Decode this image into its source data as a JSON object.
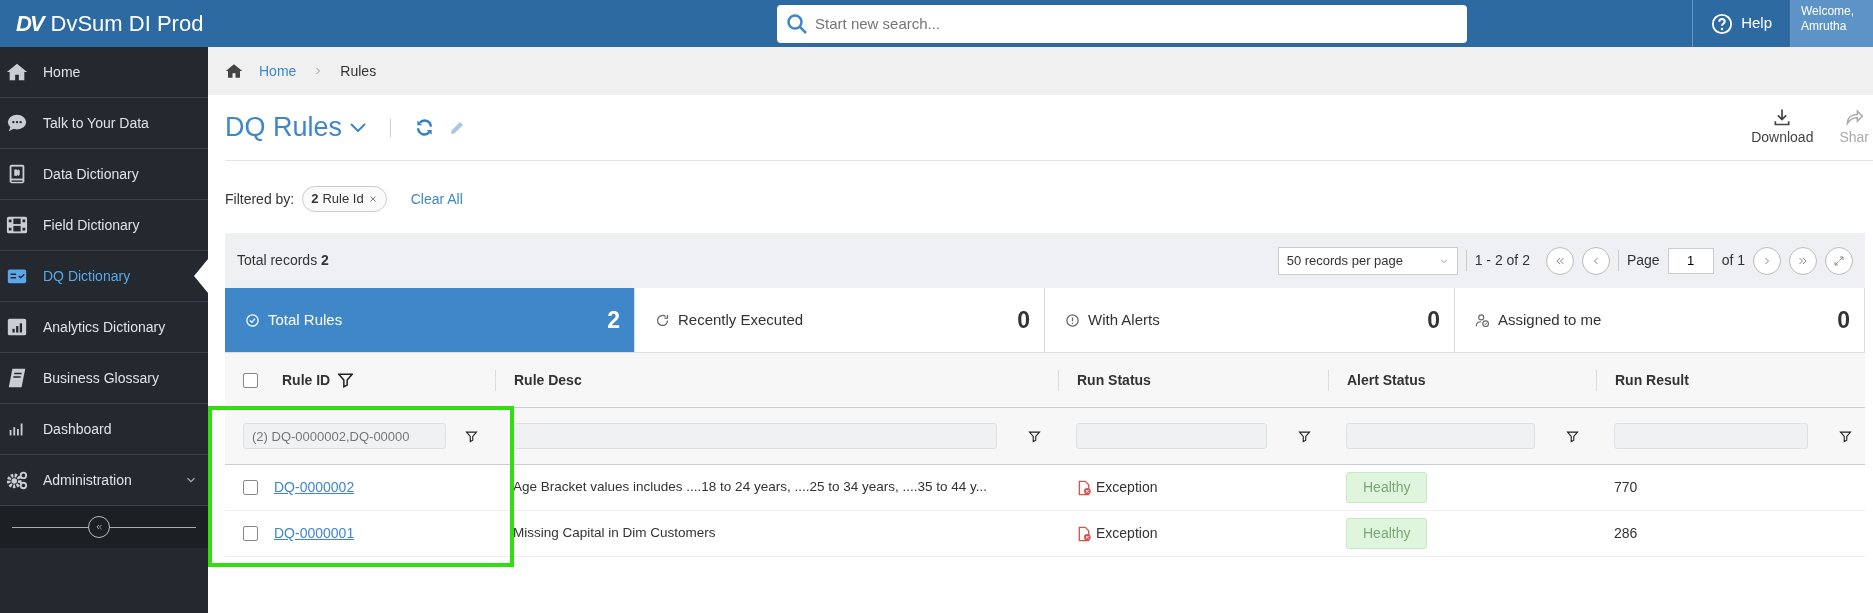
{
  "app": {
    "logo": "DV",
    "title": "DvSum DI Prod"
  },
  "search": {
    "placeholder": "Start new search..."
  },
  "help": "Help",
  "user": {
    "greeting": "Welcome,",
    "name": "Amrutha"
  },
  "sidebar": {
    "items": [
      {
        "label": "Home",
        "kind": "link",
        "selected": false
      },
      {
        "label": "Talk to Your Data",
        "kind": "link",
        "selected": false
      },
      {
        "label": "Data Dictionary",
        "kind": "link",
        "selected": false
      },
      {
        "label": "Field Dictionary",
        "kind": "link",
        "selected": false
      },
      {
        "label": "DQ Dictionary",
        "kind": "link",
        "selected": true
      },
      {
        "label": "Analytics Dictionary",
        "kind": "link",
        "selected": false
      },
      {
        "label": "Business Glossary",
        "kind": "link",
        "selected": false
      },
      {
        "label": "Dashboard",
        "kind": "link",
        "selected": false
      },
      {
        "label": "Administration",
        "kind": "group",
        "selected": false
      }
    ]
  },
  "breadcrumb": [
    "Home",
    "Rules"
  ],
  "page": {
    "title": "DQ Rules",
    "actions": [
      {
        "label": "Download",
        "disabled": false
      },
      {
        "label": "Shar",
        "disabled": true
      }
    ]
  },
  "filters": {
    "label": "Filtered by:",
    "chips": [
      {
        "count": "2",
        "label": "Rule Id"
      }
    ],
    "clear": "Clear All"
  },
  "toolbar": {
    "total_label": "Total records",
    "total": "2",
    "page_size": "50 records per page",
    "range": "1 - 2 of 2",
    "page_label": "Page",
    "page": "1",
    "of": "of 1"
  },
  "tabs": [
    {
      "label": "Total Rules",
      "count": "2",
      "selected": true
    },
    {
      "label": "Recently Executed",
      "count": "0",
      "selected": false
    },
    {
      "label": "With Alerts",
      "count": "0",
      "selected": false
    },
    {
      "label": "Assigned to me",
      "count": "0",
      "selected": false
    }
  ],
  "table": {
    "select_all": false,
    "columns": [
      {
        "label": "Rule ID",
        "filter_active": true,
        "filter_value": "(2) DQ-0000002,DQ-00000"
      },
      {
        "label": "Rule Desc",
        "filter_active": false
      },
      {
        "label": "Run Status",
        "filter_active": false
      },
      {
        "label": "Alert Status",
        "filter_active": false
      },
      {
        "label": "Run Result",
        "filter_active": false
      }
    ],
    "rows": [
      {
        "checked": false,
        "rule_id": "DQ-0000002",
        "rule_desc": "Age Bracket values includes ....18 to 24 years, ....25 to 34 years, ....35 to 44 y...",
        "run_status": "Exception",
        "alert_status": "Healthy",
        "run_result": "770"
      },
      {
        "checked": false,
        "rule_id": "DQ-0000001",
        "rule_desc": "Missing Capital in Dim Customers",
        "run_status": "Exception",
        "alert_status": "Healthy",
        "run_result": "286"
      }
    ]
  },
  "annotation": {
    "kind": "highlight-box"
  }
}
